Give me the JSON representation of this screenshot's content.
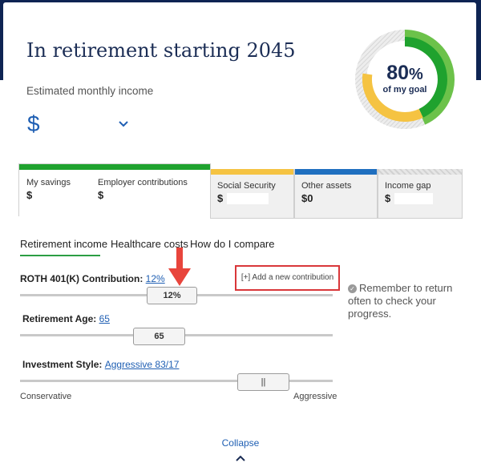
{
  "header": {
    "title": "In retirement starting 2045",
    "subtitle": "Estimated monthly income",
    "currency": "$"
  },
  "goal": {
    "percent_text": "80",
    "percent_sign": "%",
    "caption": "of my goal",
    "progress_fraction": 0.8
  },
  "tiles": {
    "my_savings": {
      "label": "My savings",
      "value": "$"
    },
    "employer": {
      "label": "Employer contributions",
      "value": "$"
    },
    "social_security": {
      "label": "Social Security",
      "value": "$"
    },
    "other_assets": {
      "label": "Other assets",
      "value": "$0"
    },
    "income_gap": {
      "label": "Income gap",
      "value": "$"
    }
  },
  "tabs": [
    "Retirement income",
    "Healthcare costs",
    "How do I compare"
  ],
  "contribution": {
    "label": "ROTH 401(K) Contribution:",
    "link": "12%",
    "slider_value": "12%",
    "add_button": "[+] Add a new contribution"
  },
  "retirement_age": {
    "label": "Retirement Age:",
    "link": "65",
    "slider_value": "65"
  },
  "investment_style": {
    "label": "Investment Style:",
    "link": "Aggressive 83/17",
    "thumb_glyph": "||",
    "min_label": "Conservative",
    "max_label": "Aggressive"
  },
  "reminder": {
    "icon": "check-circle-icon",
    "text": "Remember to return often to check your progress."
  },
  "footer": {
    "collapse": "Collapse"
  },
  "colors": {
    "navy": "#0e2453",
    "green": "#1fa22e",
    "light_green": "#6cc24a",
    "yellow": "#f5c342",
    "blue": "#1f6fbf",
    "link_blue": "#1f5fb3",
    "annotation_red": "#e8453c"
  }
}
